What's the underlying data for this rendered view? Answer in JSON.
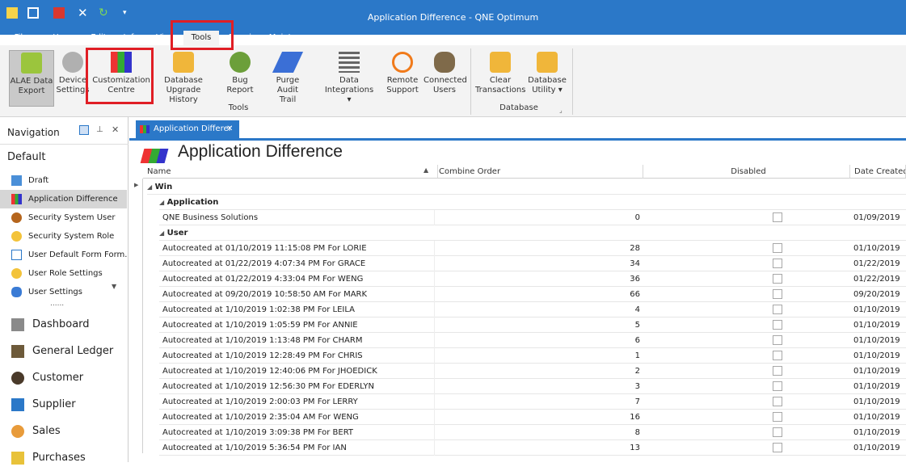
{
  "window": {
    "title": "Application Difference - QNE Optimum"
  },
  "menus": [
    "File",
    "Home",
    "Edit",
    "Info",
    "View",
    "Tools",
    "Enquiry",
    "Maintenance"
  ],
  "ribbon": {
    "buttons": [
      {
        "l1": "ALAE Data",
        "l2": "Export",
        "icon": "cube-export-icon"
      },
      {
        "l1": "Device",
        "l2": "Settings",
        "icon": "gear-icon"
      },
      {
        "l1": "Customization",
        "l2": "Centre",
        "icon": "colored-blocks-icon"
      },
      {
        "l1": "Database",
        "l2": "Upgrade History",
        "icon": "database-icon"
      },
      {
        "l1": "Bug Report",
        "l2": "",
        "icon": "bug-icon"
      },
      {
        "l1": "Purge Audit",
        "l2": "Trail",
        "icon": "eraser-icon"
      },
      {
        "l1": "Data Integrations",
        "l2": "▾",
        "icon": "list-icon"
      },
      {
        "l1": "Remote",
        "l2": "Support",
        "icon": "remote-icon"
      },
      {
        "l1": "Connected",
        "l2": "Users",
        "icon": "users-icon"
      },
      {
        "l1": "Clear",
        "l2": "Transactions",
        "icon": "clear-db-icon"
      },
      {
        "l1": "Database",
        "l2": "Utility ▾",
        "icon": "db-utility-icon"
      }
    ],
    "groups": {
      "tools": "Tools",
      "database": "Database"
    }
  },
  "nav": {
    "title": "Navigation",
    "section": "Default",
    "items": [
      "Draft",
      "Application Difference",
      "Security System User",
      "Security System Role",
      "User Default Form Form...",
      "User Role Settings",
      "User Settings"
    ],
    "dots": "......",
    "modules": [
      "Dashboard",
      "General Ledger",
      "Customer",
      "Supplier",
      "Sales",
      "Purchases"
    ]
  },
  "document": {
    "tab": "Application Differer",
    "title": "Application Difference",
    "columns": [
      "Name",
      "Combine Order",
      "Disabled",
      "Date Created"
    ],
    "group_root": "Win",
    "groups": [
      {
        "name": "Application",
        "rows": [
          {
            "name": "QNE Business Solutions",
            "order": "0",
            "date": "01/09/2019"
          }
        ]
      },
      {
        "name": "User",
        "rows": [
          {
            "name": "Autocreated at 01/10/2019 11:15:08 PM For LORIE",
            "order": "28",
            "date": "01/10/2019"
          },
          {
            "name": "Autocreated at 01/22/2019 4:07:34 PM For GRACE",
            "order": "34",
            "date": "01/22/2019"
          },
          {
            "name": "Autocreated at 01/22/2019 4:33:04 PM For WENG",
            "order": "36",
            "date": "01/22/2019"
          },
          {
            "name": "Autocreated at 09/20/2019 10:58:50 AM For MARK",
            "order": "66",
            "date": "09/20/2019"
          },
          {
            "name": "Autocreated at 1/10/2019 1:02:38 PM For LEILA",
            "order": "4",
            "date": "01/10/2019"
          },
          {
            "name": "Autocreated at 1/10/2019 1:05:59 PM For ANNIE",
            "order": "5",
            "date": "01/10/2019"
          },
          {
            "name": "Autocreated at 1/10/2019 1:13:48 PM For CHARM",
            "order": "6",
            "date": "01/10/2019"
          },
          {
            "name": "Autocreated at 1/10/2019 12:28:49 PM For CHRIS",
            "order": "1",
            "date": "01/10/2019"
          },
          {
            "name": "Autocreated at 1/10/2019 12:40:06 PM For JHOEDICK",
            "order": "2",
            "date": "01/10/2019"
          },
          {
            "name": "Autocreated at 1/10/2019 12:56:30 PM For EDERLYN",
            "order": "3",
            "date": "01/10/2019"
          },
          {
            "name": "Autocreated at 1/10/2019 2:00:03 PM For LERRY",
            "order": "7",
            "date": "01/10/2019"
          },
          {
            "name": "Autocreated at 1/10/2019 2:35:04 AM For WENG",
            "order": "16",
            "date": "01/10/2019"
          },
          {
            "name": "Autocreated at 1/10/2019 3:09:38 PM For BERT",
            "order": "8",
            "date": "01/10/2019"
          },
          {
            "name": "Autocreated at 1/10/2019 5:36:54 PM For IAN",
            "order": "13",
            "date": "01/10/2019"
          }
        ]
      }
    ]
  }
}
